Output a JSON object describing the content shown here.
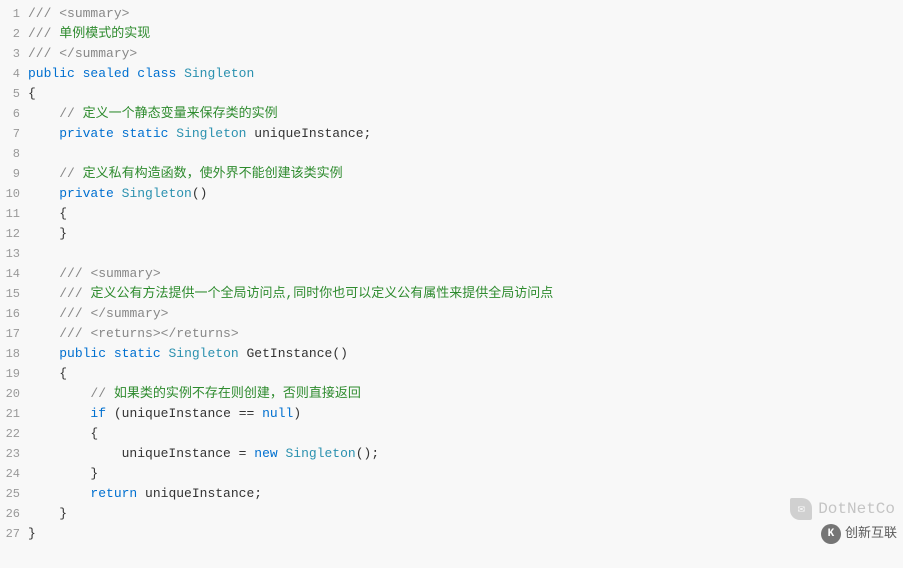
{
  "code": {
    "lines": [
      {
        "n": 1,
        "segs": [
          {
            "cls": "comment-slash",
            "t": "/// "
          },
          {
            "cls": "comment-tag",
            "t": "<summary>"
          }
        ]
      },
      {
        "n": 2,
        "segs": [
          {
            "cls": "comment-slash",
            "t": "/// "
          },
          {
            "cls": "comment-cn",
            "t": "单例模式的实现"
          }
        ]
      },
      {
        "n": 3,
        "segs": [
          {
            "cls": "comment-slash",
            "t": "/// "
          },
          {
            "cls": "comment-tag",
            "t": "</summary>"
          }
        ]
      },
      {
        "n": 4,
        "segs": [
          {
            "cls": "keyword",
            "t": "public"
          },
          {
            "cls": "plain",
            "t": " "
          },
          {
            "cls": "keyword",
            "t": "sealed"
          },
          {
            "cls": "plain",
            "t": " "
          },
          {
            "cls": "keyword",
            "t": "class"
          },
          {
            "cls": "plain",
            "t": " "
          },
          {
            "cls": "type",
            "t": "Singleton"
          }
        ]
      },
      {
        "n": 5,
        "segs": [
          {
            "cls": "brace",
            "t": "{"
          }
        ]
      },
      {
        "n": 6,
        "segs": [
          {
            "cls": "plain",
            "t": "    "
          },
          {
            "cls": "comment-slash",
            "t": "// "
          },
          {
            "cls": "comment-cn",
            "t": "定义一个静态变量来保存类的实例"
          }
        ]
      },
      {
        "n": 7,
        "segs": [
          {
            "cls": "plain",
            "t": "    "
          },
          {
            "cls": "keyword",
            "t": "private"
          },
          {
            "cls": "plain",
            "t": " "
          },
          {
            "cls": "keyword",
            "t": "static"
          },
          {
            "cls": "plain",
            "t": " "
          },
          {
            "cls": "type",
            "t": "Singleton"
          },
          {
            "cls": "plain",
            "t": " uniqueInstance;"
          }
        ]
      },
      {
        "n": 8,
        "segs": [
          {
            "cls": "plain",
            "t": ""
          }
        ]
      },
      {
        "n": 9,
        "segs": [
          {
            "cls": "plain",
            "t": "    "
          },
          {
            "cls": "comment-slash",
            "t": "// "
          },
          {
            "cls": "comment-cn",
            "t": "定义私有构造函数，使外界不能创建该类实例"
          }
        ]
      },
      {
        "n": 10,
        "segs": [
          {
            "cls": "plain",
            "t": "    "
          },
          {
            "cls": "keyword",
            "t": "private"
          },
          {
            "cls": "plain",
            "t": " "
          },
          {
            "cls": "type",
            "t": "Singleton"
          },
          {
            "cls": "paren",
            "t": "()"
          }
        ]
      },
      {
        "n": 11,
        "segs": [
          {
            "cls": "plain",
            "t": "    "
          },
          {
            "cls": "brace",
            "t": "{"
          }
        ]
      },
      {
        "n": 12,
        "segs": [
          {
            "cls": "plain",
            "t": "    "
          },
          {
            "cls": "brace",
            "t": "}"
          }
        ]
      },
      {
        "n": 13,
        "segs": [
          {
            "cls": "plain",
            "t": ""
          }
        ]
      },
      {
        "n": 14,
        "segs": [
          {
            "cls": "plain",
            "t": "    "
          },
          {
            "cls": "comment-slash",
            "t": "/// "
          },
          {
            "cls": "comment-tag",
            "t": "<summary>"
          }
        ]
      },
      {
        "n": 15,
        "segs": [
          {
            "cls": "plain",
            "t": "    "
          },
          {
            "cls": "comment-slash",
            "t": "/// "
          },
          {
            "cls": "comment-cn",
            "t": "定义公有方法提供一个全局访问点,同时你也可以定义公有属性来提供全局访问点"
          }
        ]
      },
      {
        "n": 16,
        "segs": [
          {
            "cls": "plain",
            "t": "    "
          },
          {
            "cls": "comment-slash",
            "t": "/// "
          },
          {
            "cls": "comment-tag",
            "t": "</summary>"
          }
        ]
      },
      {
        "n": 17,
        "segs": [
          {
            "cls": "plain",
            "t": "    "
          },
          {
            "cls": "comment-slash",
            "t": "/// "
          },
          {
            "cls": "comment-tag",
            "t": "<returns></returns>"
          }
        ]
      },
      {
        "n": 18,
        "segs": [
          {
            "cls": "plain",
            "t": "    "
          },
          {
            "cls": "keyword",
            "t": "public"
          },
          {
            "cls": "plain",
            "t": " "
          },
          {
            "cls": "keyword",
            "t": "static"
          },
          {
            "cls": "plain",
            "t": " "
          },
          {
            "cls": "type",
            "t": "Singleton"
          },
          {
            "cls": "plain",
            "t": " GetInstance"
          },
          {
            "cls": "paren",
            "t": "()"
          }
        ]
      },
      {
        "n": 19,
        "segs": [
          {
            "cls": "plain",
            "t": "    "
          },
          {
            "cls": "brace",
            "t": "{"
          }
        ]
      },
      {
        "n": 20,
        "segs": [
          {
            "cls": "plain",
            "t": "        "
          },
          {
            "cls": "comment-slash",
            "t": "// "
          },
          {
            "cls": "comment-cn",
            "t": "如果类的实例不存在则创建，否则直接返回"
          }
        ]
      },
      {
        "n": 21,
        "segs": [
          {
            "cls": "plain",
            "t": "        "
          },
          {
            "cls": "keyword",
            "t": "if"
          },
          {
            "cls": "plain",
            "t": " "
          },
          {
            "cls": "paren",
            "t": "("
          },
          {
            "cls": "plain",
            "t": "uniqueInstance "
          },
          {
            "cls": "op",
            "t": "=="
          },
          {
            "cls": "plain",
            "t": " "
          },
          {
            "cls": "kw-null",
            "t": "null"
          },
          {
            "cls": "paren",
            "t": ")"
          }
        ]
      },
      {
        "n": 22,
        "segs": [
          {
            "cls": "plain",
            "t": "        "
          },
          {
            "cls": "brace",
            "t": "{"
          }
        ]
      },
      {
        "n": 23,
        "segs": [
          {
            "cls": "plain",
            "t": "            uniqueInstance "
          },
          {
            "cls": "op",
            "t": "="
          },
          {
            "cls": "plain",
            "t": " "
          },
          {
            "cls": "kw-new",
            "t": "new"
          },
          {
            "cls": "plain",
            "t": " "
          },
          {
            "cls": "type",
            "t": "Singleton"
          },
          {
            "cls": "paren",
            "t": "()"
          },
          {
            "cls": "plain",
            "t": ";"
          }
        ]
      },
      {
        "n": 24,
        "segs": [
          {
            "cls": "plain",
            "t": "        "
          },
          {
            "cls": "brace",
            "t": "}"
          }
        ]
      },
      {
        "n": 25,
        "segs": [
          {
            "cls": "plain",
            "t": "        "
          },
          {
            "cls": "kw-return",
            "t": "return"
          },
          {
            "cls": "plain",
            "t": " uniqueInstance;"
          }
        ]
      },
      {
        "n": 26,
        "segs": [
          {
            "cls": "plain",
            "t": "    "
          },
          {
            "cls": "brace",
            "t": "}"
          }
        ]
      },
      {
        "n": 27,
        "segs": [
          {
            "cls": "brace",
            "t": "}"
          }
        ]
      }
    ]
  },
  "watermark1": {
    "text": "DotNetCo"
  },
  "watermark2": {
    "text": "创新互联"
  }
}
